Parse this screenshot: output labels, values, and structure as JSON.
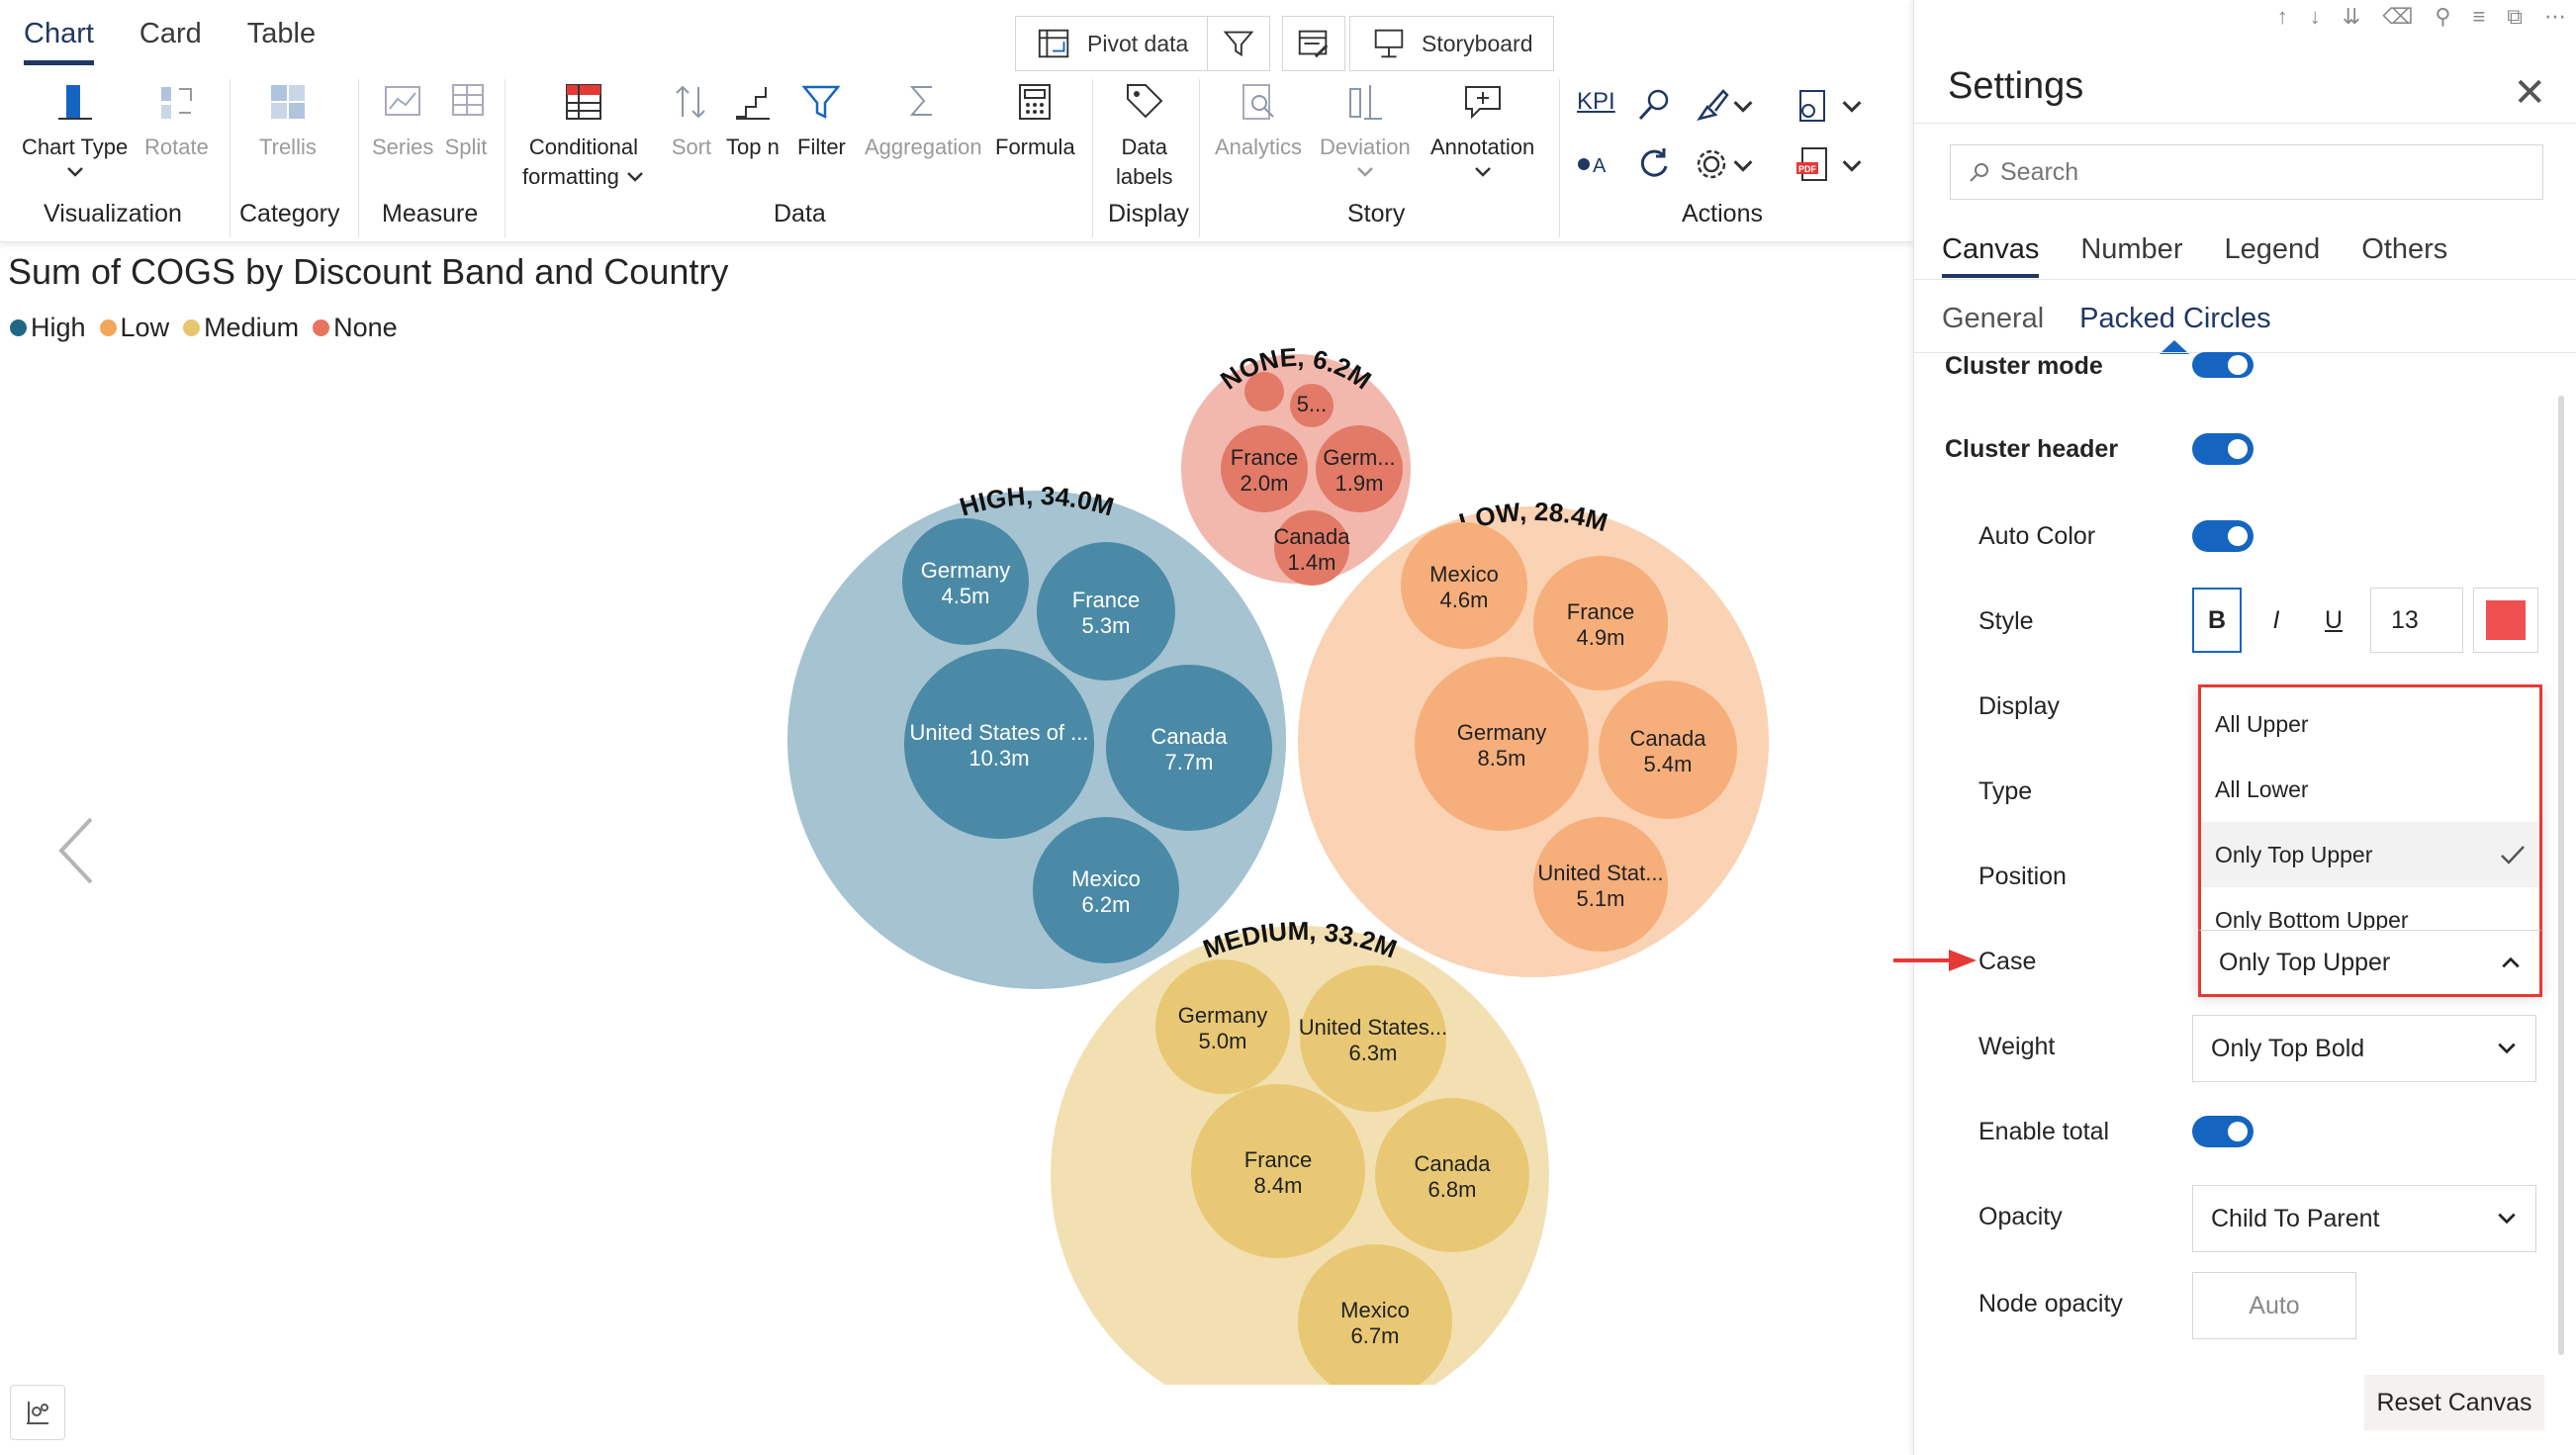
{
  "ribbon": {
    "tabs": [
      "Chart",
      "Card",
      "Table"
    ],
    "top_buttons": {
      "pivot": "Pivot data",
      "storyboard": "Storyboard"
    },
    "items": {
      "chart_type": "Chart Type",
      "rotate": "Rotate",
      "trellis": "Trellis",
      "series": "Series",
      "split": "Split",
      "conditional_1": "Conditional",
      "conditional_2": "formatting",
      "sort": "Sort",
      "topn": "Top n",
      "filter": "Filter",
      "aggregation": "Aggregation",
      "formula": "Formula",
      "data_labels_1": "Data",
      "data_labels_2": "labels",
      "analytics": "Analytics",
      "deviation": "Deviation",
      "annotation": "Annotation",
      "kpi": "KPI"
    },
    "groups": {
      "visualization": "Visualization",
      "category": "Category",
      "measure": "Measure",
      "data": "Data",
      "display": "Display",
      "story": "Story",
      "actions": "Actions"
    }
  },
  "chart": {
    "title": "Sum of COGS by Discount Band and Country",
    "legend": [
      {
        "label": "High",
        "color": "#1f6885"
      },
      {
        "label": "Low",
        "color": "#f2a65a"
      },
      {
        "label": "Medium",
        "color": "#e8c66e"
      },
      {
        "label": "None",
        "color": "#e8735e"
      }
    ]
  },
  "chart_data": {
    "type": "packed-circles",
    "title": "Sum of COGS by Discount Band and Country",
    "clusters": [
      {
        "name": "HIGH",
        "total": "34.0M",
        "color": "#1f6885",
        "children": [
          {
            "label": "Germany",
            "value": "4.5m"
          },
          {
            "label": "France",
            "value": "5.3m"
          },
          {
            "label": "United States of ...",
            "value": "10.3m"
          },
          {
            "label": "Canada",
            "value": "7.7m"
          },
          {
            "label": "Mexico",
            "value": "6.2m"
          }
        ]
      },
      {
        "name": "NONE",
        "total": "6.2M",
        "color": "#e8735e",
        "children": [
          {
            "label": "5...",
            "value": ""
          },
          {
            "label": "France",
            "value": "2.0m"
          },
          {
            "label": "Germ...",
            "value": "1.9m"
          },
          {
            "label": "Canada",
            "value": "1.4m"
          }
        ]
      },
      {
        "name": "LOW",
        "total": "28.4M",
        "color": "#f2a65a",
        "children": [
          {
            "label": "Mexico",
            "value": "4.6m"
          },
          {
            "label": "France",
            "value": "4.9m"
          },
          {
            "label": "Germany",
            "value": "8.5m"
          },
          {
            "label": "Canada",
            "value": "5.4m"
          },
          {
            "label": "United Stat...",
            "value": "5.1m"
          }
        ]
      },
      {
        "name": "MEDIUM",
        "total": "33.2M",
        "color": "#e8c66e",
        "children": [
          {
            "label": "Germany",
            "value": "5.0m"
          },
          {
            "label": "United States...",
            "value": "6.3m"
          },
          {
            "label": "France",
            "value": "8.4m"
          },
          {
            "label": "Canada",
            "value": "6.8m"
          },
          {
            "label": "Mexico",
            "value": "6.7m"
          }
        ]
      }
    ]
  },
  "settings": {
    "title": "Settings",
    "search_placeholder": "Search",
    "tabs": [
      "Canvas",
      "Number",
      "Legend",
      "Others"
    ],
    "subtabs": [
      "General",
      "Packed Circles"
    ],
    "rows": {
      "cluster_mode": "Cluster mode",
      "cluster_header": "Cluster header",
      "auto_color": "Auto Color",
      "style": "Style",
      "display": "Display",
      "type": "Type",
      "position": "Position",
      "case": "Case",
      "weight": "Weight",
      "enable_total": "Enable total",
      "opacity": "Opacity",
      "node_opacity": "Node opacity"
    },
    "style_controls": {
      "bold": "B",
      "italic": "I",
      "underline": "U",
      "font_size": "13",
      "color": "#f05050"
    },
    "case_value": "Only Top Upper",
    "case_options": [
      "All Upper",
      "All Lower",
      "Only Top Upper",
      "Only Bottom Upper"
    ],
    "weight_value": "Only Top Bold",
    "opacity_value": "Child To Parent",
    "node_opacity_value": "Auto",
    "reset_label": "Reset Canvas"
  }
}
